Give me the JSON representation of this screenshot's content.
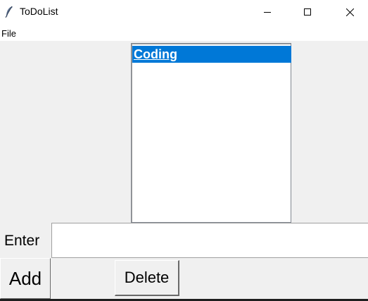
{
  "window": {
    "title": "ToDoList",
    "icon": "feather-icon",
    "controls": [
      "minimize-icon",
      "maximize-icon",
      "close-icon"
    ]
  },
  "menu": {
    "file_label": "File"
  },
  "todo_list": {
    "items": [
      {
        "label": "Coding",
        "selected": true
      }
    ],
    "selection_color": "#0078d7"
  },
  "entry": {
    "label": "Enter",
    "value": ""
  },
  "buttons": {
    "add_label": "Add",
    "delete_label": "Delete"
  }
}
